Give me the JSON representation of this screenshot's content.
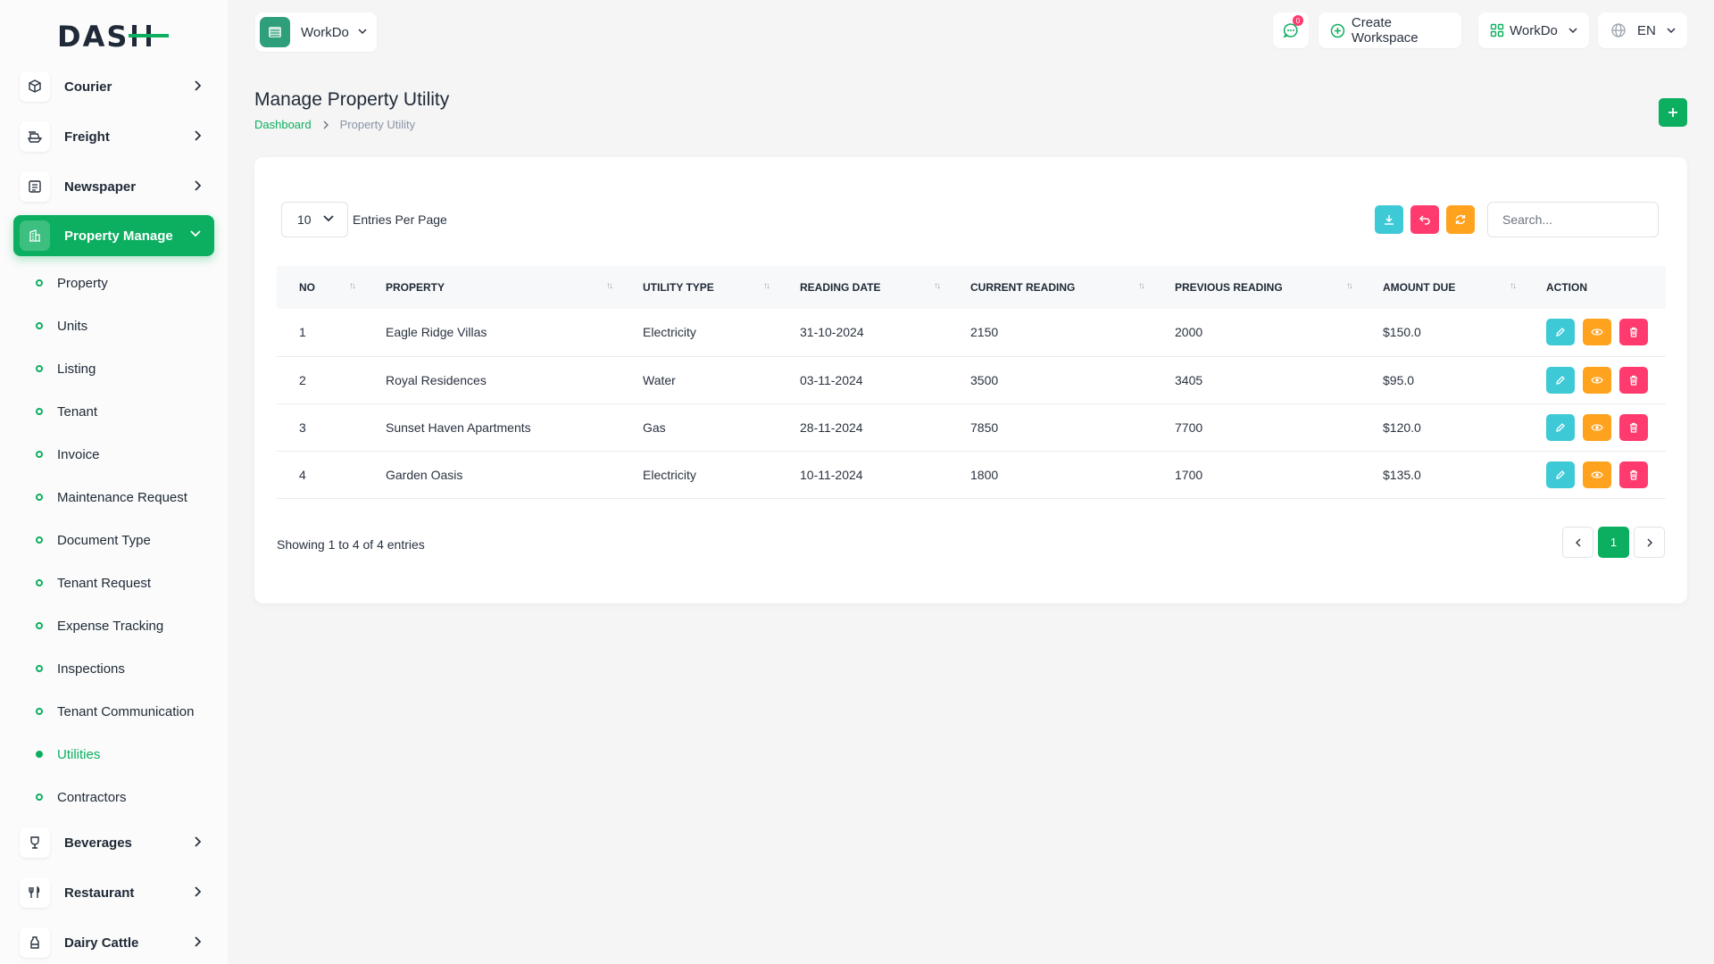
{
  "brand": {
    "logo_text": "DASH",
    "accent": "#0caf60"
  },
  "sidebar": {
    "top_items": [
      {
        "label": "Courier",
        "icon": "box-icon"
      },
      {
        "label": "Freight",
        "icon": "ship-icon"
      },
      {
        "label": "Newspaper",
        "icon": "newspaper-icon"
      }
    ],
    "active_module": {
      "label": "Property Manage",
      "icon": "building-icon"
    },
    "sub_items": [
      "Property",
      "Units",
      "Listing",
      "Tenant",
      "Invoice",
      "Maintenance Request",
      "Document Type",
      "Tenant Request",
      "Expense Tracking",
      "Inspections",
      "Tenant Communication",
      "Utilities",
      "Contractors"
    ],
    "current_sub_item": "Utilities",
    "bottom_items": [
      {
        "label": "Beverages",
        "icon": "glass-icon"
      },
      {
        "label": "Restaurant",
        "icon": "utensils-icon"
      },
      {
        "label": "Dairy Cattle",
        "icon": "bottle-icon"
      }
    ]
  },
  "header": {
    "workspace": "WorkDo",
    "notification_count": "0",
    "create_workspace": "Create Workspace",
    "workspace_menu": "WorkDo",
    "language": "EN"
  },
  "page": {
    "title": "Manage Property Utility",
    "breadcrumb_home": "Dashboard",
    "breadcrumb_current": "Property Utility"
  },
  "table_controls": {
    "entries_value": "10",
    "entries_label": "Entries Per Page",
    "search_placeholder": "Search..."
  },
  "table": {
    "columns": [
      "NO",
      "PROPERTY",
      "UTILITY TYPE",
      "READING DATE",
      "CURRENT READING",
      "PREVIOUS READING",
      "AMOUNT DUE",
      "ACTION"
    ],
    "rows": [
      {
        "no": "1",
        "property": "Eagle Ridge Villas",
        "type": "Electricity",
        "date": "31-10-2024",
        "current": "2150",
        "previous": "2000",
        "amount": "$150.0"
      },
      {
        "no": "2",
        "property": "Royal Residences",
        "type": "Water",
        "date": "03-11-2024",
        "current": "3500",
        "previous": "3405",
        "amount": "$95.0"
      },
      {
        "no": "3",
        "property": "Sunset Haven Apartments",
        "type": "Gas",
        "date": "28-11-2024",
        "current": "7850",
        "previous": "7700",
        "amount": "$120.0"
      },
      {
        "no": "4",
        "property": "Garden Oasis",
        "type": "Electricity",
        "date": "10-11-2024",
        "current": "1800",
        "previous": "1700",
        "amount": "$135.0"
      }
    ]
  },
  "footer": {
    "info": "Showing 1 to 4 of 4 entries",
    "current_page": "1"
  },
  "colors": {
    "edit": "#3ec9d6",
    "view": "#ffa21d",
    "delete": "#ff3a6e",
    "download": "#3ec9d6",
    "reset": "#ff3a6e",
    "refresh": "#ffa21d"
  }
}
